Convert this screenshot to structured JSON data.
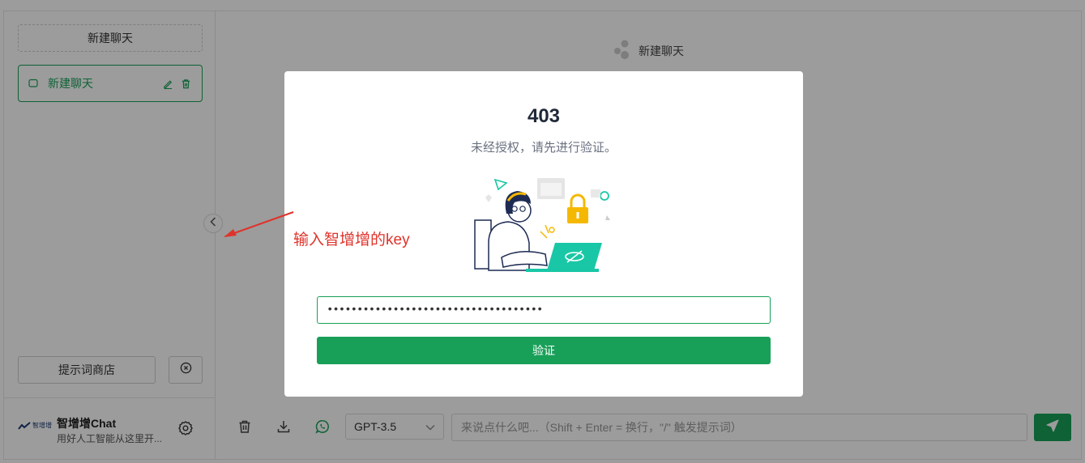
{
  "sidebar": {
    "new_chat_label": "新建聊天",
    "history": [
      {
        "label": "新建聊天"
      }
    ],
    "prompt_store_label": "提示词商店",
    "user": {
      "brand_logo_text": "智增增",
      "name": "智增增Chat",
      "description": "用好人工智能从这里开..."
    }
  },
  "main": {
    "header_title": "新建聊天",
    "footer": {
      "model_value": "GPT-3.5",
      "input_placeholder": "来说点什么吧...（Shift + Enter = 换行，\"/\" 触发提示词）"
    }
  },
  "modal": {
    "code": "403",
    "message": "未经授权，请先进行验证。",
    "key_value": "••••••••••••••••••••••••••••••••••••",
    "verify_label": "验证"
  },
  "annotation": {
    "text": "输入智增增的key"
  },
  "colors": {
    "accent": "#18a058",
    "overlay": "rgba(0,0,0,0.39)",
    "annotation": "#e0332b",
    "illustration_teal": "#19c7a6",
    "illustration_yellow": "#f5b800"
  },
  "icons": {
    "history": "chat-bubble-icon",
    "edit": "edit-icon",
    "delete": "delete-icon",
    "clear": "clear-circle-icon",
    "settings": "gear-icon",
    "collapse": "chevron-left-icon",
    "header": "chatbot-dots-icon",
    "trash": "trash-icon",
    "download": "download-icon",
    "whatsapp": "whatsapp-icon",
    "dropdown": "chevron-down-icon",
    "send": "send-icon"
  }
}
